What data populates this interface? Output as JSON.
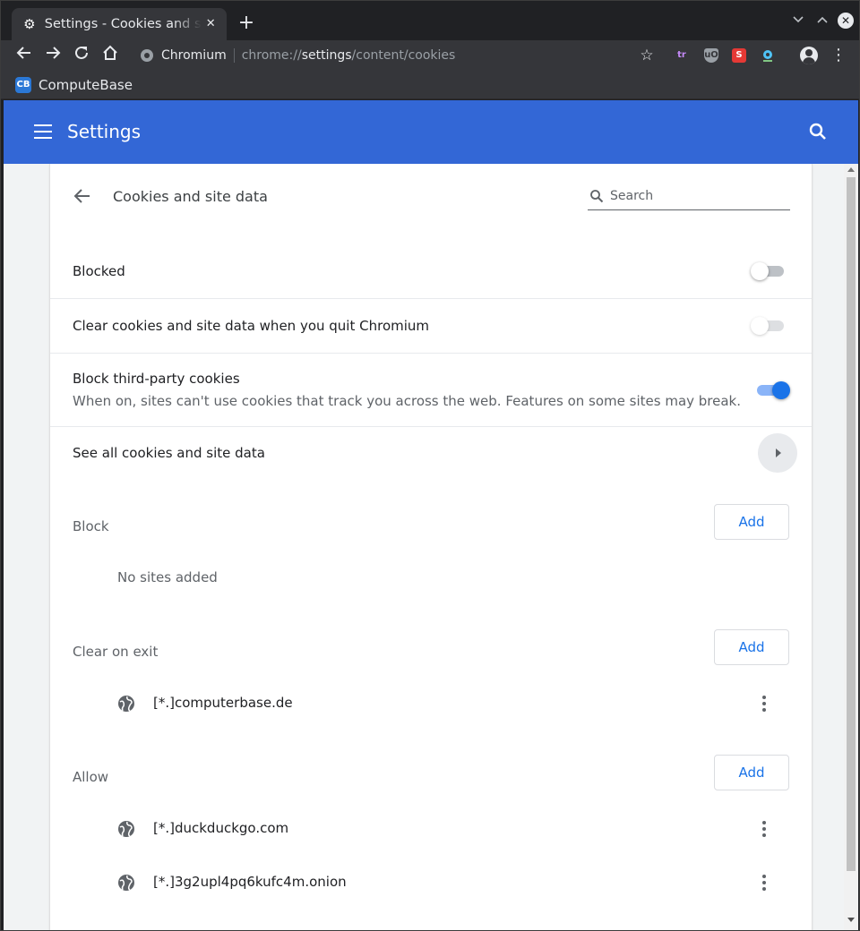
{
  "browser": {
    "tab_title": "Settings - Cookies and site data",
    "tab_close": "✕",
    "new_tab": "+",
    "omnibox_chip": "Chromium",
    "url_scheme": "chrome://",
    "url_host": "settings",
    "url_path": "/content/cookies",
    "bookmark_label": "ComputeBase",
    "bookmark_icon_text": "CB",
    "extensions": [
      {
        "name": "translate-extension-icon",
        "text": "tr",
        "color": "#c58af9"
      },
      {
        "name": "ublock-origin-icon",
        "text": "uO",
        "color": "#9aa0a6"
      },
      {
        "name": "stylus-extension-icon",
        "text": "S",
        "color": "#e53935"
      },
      {
        "name": "location-extension-icon",
        "text": "",
        "color": "#4fc3f7"
      }
    ]
  },
  "header": {
    "title": "Settings"
  },
  "page": {
    "title": "Cookies and site data",
    "search_placeholder": "Search",
    "rows": {
      "blocked": "Blocked",
      "clear_on_quit": "Clear cookies and site data when you quit Chromium",
      "block_third_party": "Block third-party cookies",
      "block_third_party_desc": "When on, sites can't use cookies that track you across the web. Features on some sites may break.",
      "see_all": "See all cookies and site data"
    },
    "toggles": {
      "blocked": false,
      "clear_on_quit": false,
      "block_third_party": true
    },
    "sections": {
      "block": {
        "label": "Block",
        "add": "Add",
        "empty": "No sites added"
      },
      "clear_on_exit": {
        "label": "Clear on exit",
        "add": "Add",
        "sites": [
          "[*.]computerbase.de"
        ]
      },
      "allow": {
        "label": "Allow",
        "add": "Add",
        "sites": [
          "[*.]duckduckgo.com",
          "[*.]3g2upl4pq6kufc4m.onion"
        ]
      }
    }
  },
  "colors": {
    "header_blue": "#3367d6",
    "accent": "#1a73e8"
  }
}
